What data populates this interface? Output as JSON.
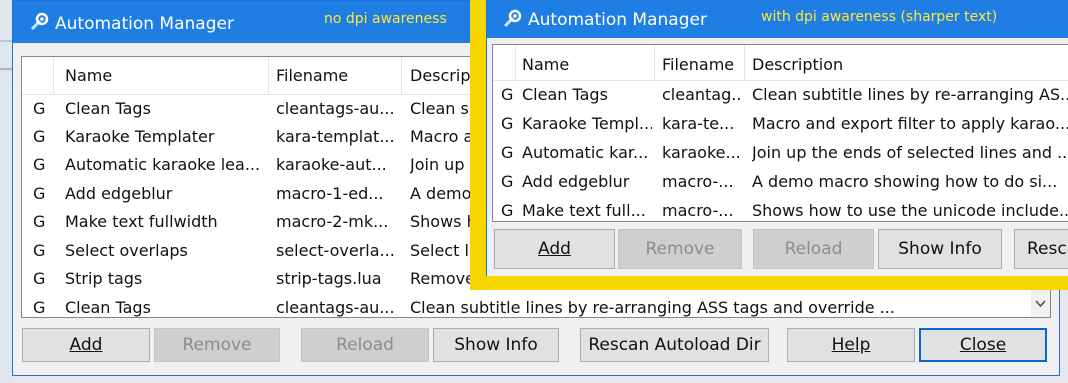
{
  "back_window": {
    "title": "Automation Manager",
    "note": "no dpi awareness",
    "columns": {
      "flag": "",
      "name": "Name",
      "filename": "Filename",
      "description": "Descript"
    },
    "rows": [
      {
        "flag": "G",
        "name": "Clean Tags",
        "filename": "cleantags-au...",
        "description": "Clean su"
      },
      {
        "flag": "G",
        "name": "Karaoke Templater",
        "filename": "kara-templat...",
        "description": "Macro a"
      },
      {
        "flag": "G",
        "name": "Automatic karaoke lea...",
        "filename": "karaoke-aut...",
        "description": "Join up"
      },
      {
        "flag": "G",
        "name": "Add edgeblur",
        "filename": "macro-1-ed...",
        "description": "A demo"
      },
      {
        "flag": "G",
        "name": "Make text fullwidth",
        "filename": "macro-2-mk...",
        "description": "Shows h"
      },
      {
        "flag": "G",
        "name": "Select overlaps",
        "filename": "select-overla...",
        "description": "Select li"
      },
      {
        "flag": "G",
        "name": "Strip tags",
        "filename": "strip-tags.lua",
        "description": "Remove"
      },
      {
        "flag": "G",
        "name": "Clean Tags",
        "filename": "cleantags-au...",
        "description": "Clean subtitle lines by re-arranging ASS tags and override ..."
      }
    ],
    "buttons": {
      "add": "Add",
      "remove": "Remove",
      "reload": "Reload",
      "show_info": "Show Info",
      "rescan": "Rescan Autoload Dir",
      "help": "Help",
      "close": "Close"
    }
  },
  "front_window": {
    "title": "Automation Manager",
    "note": "with dpi awareness (sharper text)",
    "columns": {
      "name": "Name",
      "filename": "Filename",
      "description": "Description"
    },
    "rows": [
      {
        "flag": "G",
        "name": "Clean Tags",
        "filename": "cleantag...",
        "description": "Clean subtitle lines by re-arranging AS..."
      },
      {
        "flag": "G",
        "name": "Karaoke Templ...",
        "filename": "kara-te...",
        "description": "Macro and export filter to apply karao..."
      },
      {
        "flag": "G",
        "name": "Automatic kar...",
        "filename": "karaoke...",
        "description": "Join up the ends of selected lines and ..."
      },
      {
        "flag": "G",
        "name": "Add edgeblur",
        "filename": "macro-...",
        "description": "A demo macro showing how to do si..."
      },
      {
        "flag": "G",
        "name": "Make text full...",
        "filename": "macro-...",
        "description": "Shows how to use the unicode include..."
      }
    ],
    "buttons": {
      "add": "Add",
      "remove": "Remove",
      "reload": "Reload",
      "show_info": "Show Info",
      "rescan": "Resca"
    }
  },
  "icons": {
    "app": "automation-gear-icon",
    "scroll_down": "chevron-down-icon"
  },
  "colors": {
    "titlebar": "#1e7ee4",
    "note_text": "#ffe83a",
    "highlight_frame": "#f7d600"
  }
}
